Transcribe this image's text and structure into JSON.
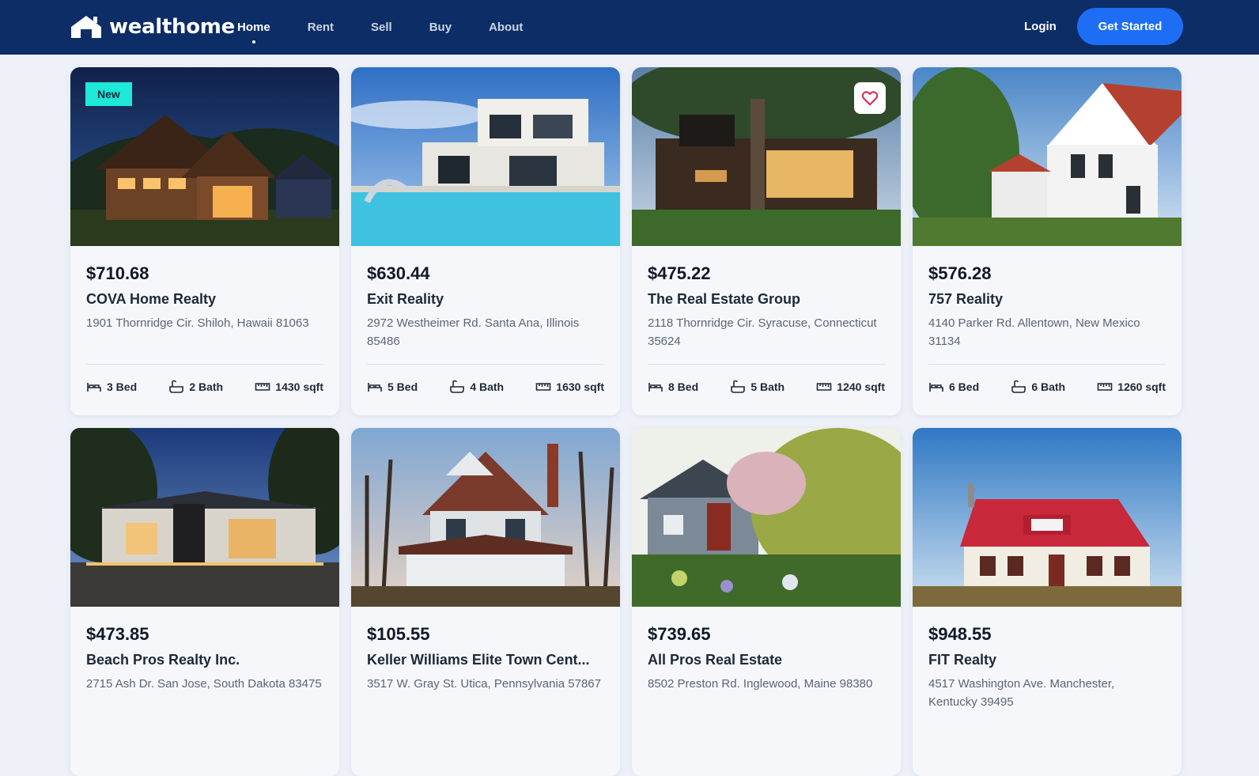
{
  "brand": {
    "name": "wealthome",
    "icon": "house-logo-icon"
  },
  "nav": {
    "items": [
      {
        "label": "Home",
        "active": true
      },
      {
        "label": "Rent",
        "active": false
      },
      {
        "label": "Sell",
        "active": false
      },
      {
        "label": "Buy",
        "active": false
      },
      {
        "label": "About",
        "active": false
      }
    ],
    "login_label": "Login",
    "cta_label": "Get Started"
  },
  "colors": {
    "navbar": "#0d2d66",
    "accent": "#1e6ef5",
    "badge": "#1ee8d8",
    "heart": "#e11d48",
    "page": "#eef2f8"
  },
  "listings": [
    {
      "price": "$710.68",
      "name": "COVA Home Realty",
      "address": "1901 Thornridge Cir. Shiloh, Hawaii 81063",
      "beds": "3 Bed",
      "baths": "2 Bath",
      "area": "1430 sqft",
      "badge": "New",
      "favorite": false,
      "image": "night-timber-house"
    },
    {
      "price": "$630.44",
      "name": "Exit Reality",
      "address": "2972 Westheimer Rd. Santa Ana, Illinois 85486",
      "beds": "5 Bed",
      "baths": "4 Bath",
      "area": "1630 sqft",
      "badge": "",
      "favorite": false,
      "image": "modern-villa-pool"
    },
    {
      "price": "$475.22",
      "name": "The Real Estate Group",
      "address": "2118 Thornridge Cir. Syracuse, Connecticut 35624",
      "beds": "8 Bed",
      "baths": "5 Bath",
      "area": "1240 sqft",
      "badge": "",
      "favorite": true,
      "image": "modern-house-tree"
    },
    {
      "price": "$576.28",
      "name": "757 Reality",
      "address": "4140 Parker Rd. Allentown, New Mexico 31134",
      "beds": "6 Bed",
      "baths": "6 Bath",
      "area": "1260 sqft",
      "badge": "",
      "favorite": false,
      "image": "white-townhouses"
    },
    {
      "price": "$473.85",
      "name": "Beach Pros Realty Inc.",
      "address": "2715 Ash Dr. San Jose, South Dakota 83475",
      "beds": "",
      "baths": "",
      "area": "",
      "badge": "",
      "favorite": false,
      "image": "lit-modern-home"
    },
    {
      "price": "$105.55",
      "name": "Keller Williams Elite Town Cent...",
      "address": "3517 W. Gray St. Utica, Pennsylvania 57867",
      "beds": "",
      "baths": "",
      "area": "",
      "badge": "",
      "favorite": false,
      "image": "victorian-house"
    },
    {
      "price": "$739.65",
      "name": "All Pros Real Estate",
      "address": "8502 Preston Rd. Inglewood, Maine 98380",
      "beds": "",
      "baths": "",
      "area": "",
      "badge": "",
      "favorite": false,
      "image": "garden-cottage"
    },
    {
      "price": "$948.55",
      "name": "FIT Realty",
      "address": "4517 Washington Ave. Manchester, Kentucky 39495",
      "beds": "",
      "baths": "",
      "area": "",
      "badge": "",
      "favorite": false,
      "image": "red-roof-house"
    }
  ]
}
